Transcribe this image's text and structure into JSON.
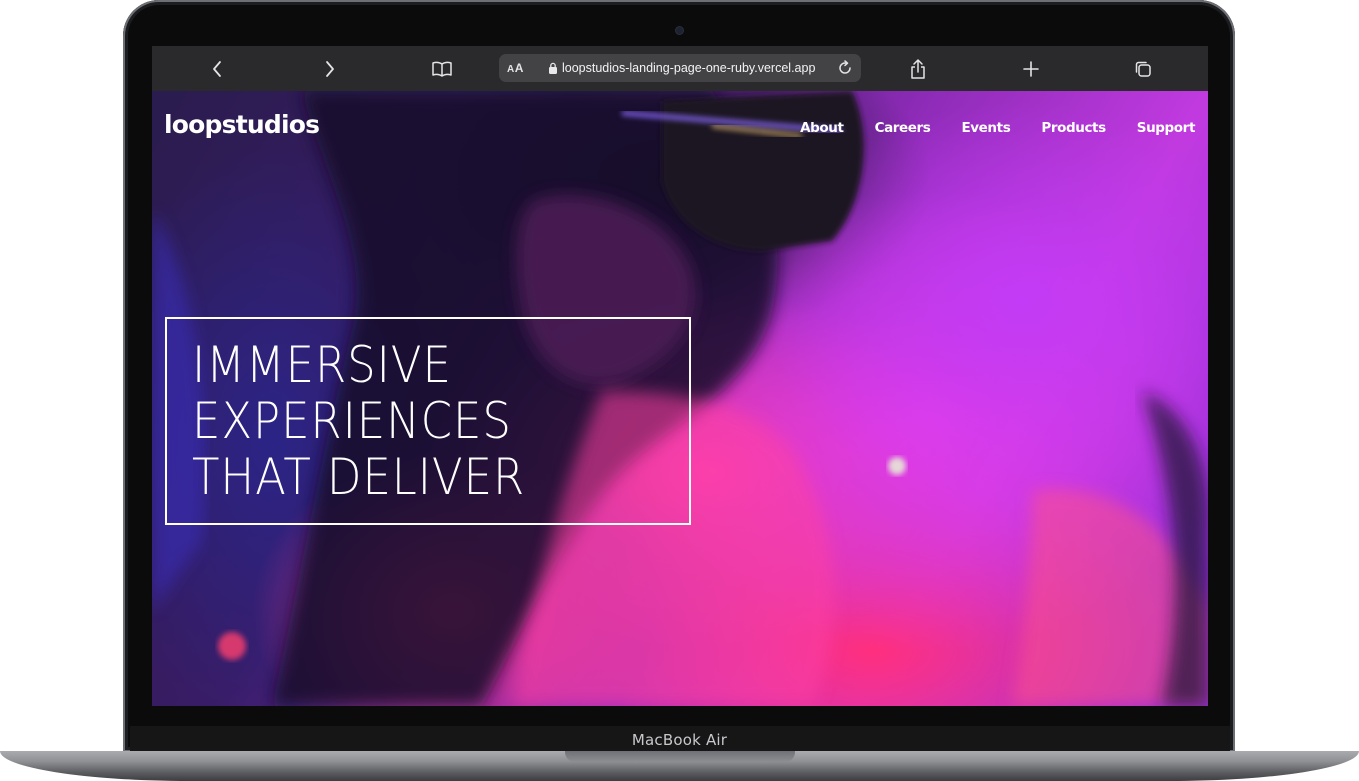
{
  "device": {
    "model_label": "MacBook Air"
  },
  "browser": {
    "reader_label_small": "A",
    "reader_label_big": "A",
    "url": "loopstudios-landing-page-one-ruby.vercel.app"
  },
  "site": {
    "brand": "loopstudios",
    "nav": [
      "About",
      "Careers",
      "Events",
      "Products",
      "Support"
    ],
    "hero_lines": [
      "IMMERSIVE",
      "EXPERIENCES",
      "THAT DELIVER"
    ]
  },
  "colors": {
    "toolbar": "#2a2a2c",
    "address_bar": "#434346",
    "hero_pink": "#ff3fa4",
    "hero_purple": "#c33bf6",
    "text": "#ffffff"
  }
}
